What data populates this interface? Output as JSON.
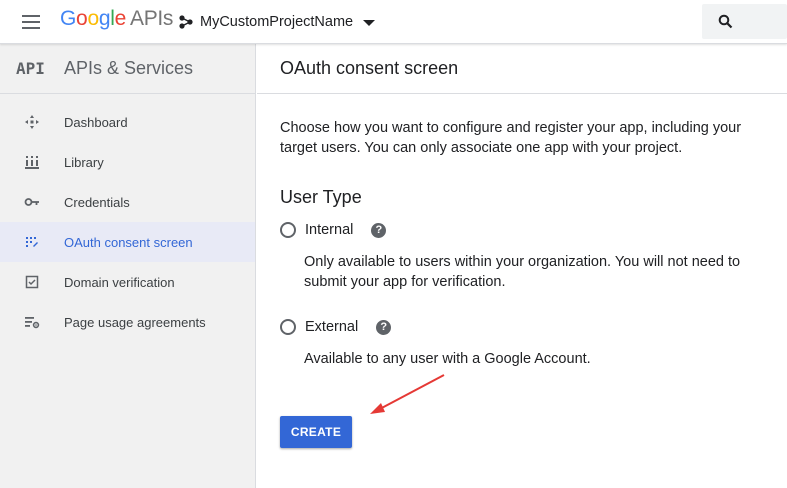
{
  "topbar": {
    "logo": {
      "google": [
        "G",
        "o",
        "o",
        "g",
        "l",
        "e"
      ],
      "apis": "APIs"
    },
    "project_name": "MyCustomProjectName",
    "icons": {
      "menu": "hamburger-menu-icon",
      "project": "project-nodes-icon",
      "dropdown": "caret-down-icon",
      "search": "search-icon"
    }
  },
  "sidebar": {
    "badge": "API",
    "title": "APIs & Services",
    "items": [
      {
        "label": "Dashboard",
        "icon": "dashboard-icon",
        "active": false
      },
      {
        "label": "Library",
        "icon": "library-icon",
        "active": false
      },
      {
        "label": "Credentials",
        "icon": "key-icon",
        "active": false
      },
      {
        "label": "OAuth consent screen",
        "icon": "consent-icon",
        "active": true
      },
      {
        "label": "Domain verification",
        "icon": "checkbox-icon",
        "active": false
      },
      {
        "label": "Page usage agreements",
        "icon": "settings-list-icon",
        "active": false
      }
    ]
  },
  "main": {
    "title": "OAuth consent screen",
    "intro": "Choose how you want to configure and register your app, including your target users. You can only associate one app with your project.",
    "user_type": {
      "heading": "User Type",
      "options": [
        {
          "label": "Internal",
          "description": "Only available to users within your organization. You will not need to submit your app for verification.",
          "selected": false
        },
        {
          "label": "External",
          "description": "Available to any user with a Google Account.",
          "selected": false
        }
      ],
      "help_glyph": "?"
    },
    "create_button": "CREATE"
  },
  "colors": {
    "accent": "#3367d6",
    "sidebar_bg": "#f1f1f1",
    "active_item_bg": "#e8eaf6",
    "annotation_arrow": "#e53935"
  }
}
